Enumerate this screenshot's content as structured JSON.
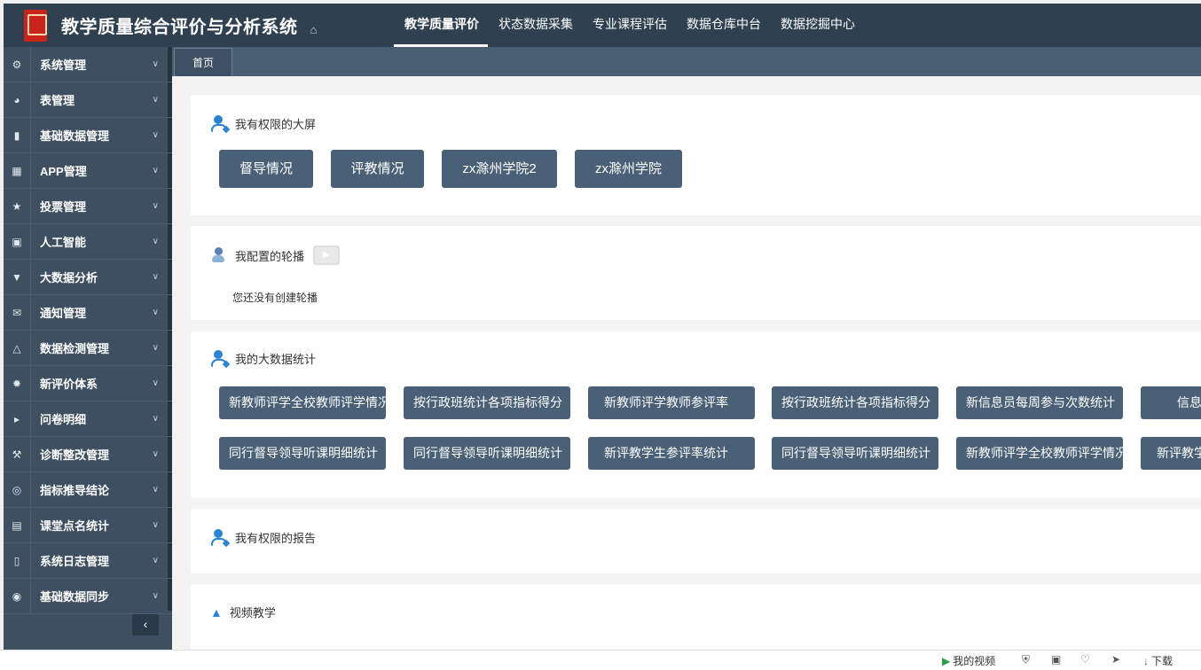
{
  "header": {
    "title": "教学质量综合评价与分析系统",
    "home_icon": "home-icon",
    "nav": [
      {
        "label": "教学质量评价",
        "active": true
      },
      {
        "label": "状态数据采集",
        "active": false
      },
      {
        "label": "专业课程评估",
        "active": false
      },
      {
        "label": "数据仓库中台",
        "active": false
      },
      {
        "label": "数据挖掘中心",
        "active": false
      }
    ]
  },
  "sidebar": {
    "items": [
      {
        "label": "系统管理",
        "icon": "gears-icon"
      },
      {
        "label": "表管理",
        "icon": "dashboard-icon"
      },
      {
        "label": "基础数据管理",
        "icon": "bookmark-icon"
      },
      {
        "label": "APP管理",
        "icon": "grid-icon"
      },
      {
        "label": "投票管理",
        "icon": "trophy-icon"
      },
      {
        "label": "人工智能",
        "icon": "archive-icon"
      },
      {
        "label": "大数据分析",
        "icon": "filter-icon"
      },
      {
        "label": "通知管理",
        "icon": "envelope-icon"
      },
      {
        "label": "数据检测管理",
        "icon": "flask-icon"
      },
      {
        "label": "新评价体系",
        "icon": "gear-icon"
      },
      {
        "label": "问卷明细",
        "icon": "bullhorn-icon"
      },
      {
        "label": "诊断整改管理",
        "icon": "wrench-icon"
      },
      {
        "label": "指标推导结论",
        "icon": "compass-icon"
      },
      {
        "label": "课堂点名统计",
        "icon": "bar-chart-icon"
      },
      {
        "label": "系统日志管理",
        "icon": "book-icon"
      },
      {
        "label": "基础数据同步",
        "icon": "eye-icon"
      }
    ],
    "collapse_label": "‹"
  },
  "tabs": [
    {
      "label": "首页"
    }
  ],
  "cards": {
    "screens": {
      "title": "我有权限的大屏",
      "buttons": [
        "督导情况",
        "评教情况",
        "zx滁州学院2",
        "zx滁州学院"
      ]
    },
    "carousel": {
      "title": "我配置的轮播",
      "empty_text": "您还没有创建轮播"
    },
    "stats": {
      "title": "我的大数据统计",
      "row1": [
        "新教师评学全校教师评学情况",
        "按行政班统计各项指标得分",
        "新教师评学教师参评率",
        "按行政班统计各项指标得分",
        "新信息员每周参与次数统计",
        "信息"
      ],
      "row2": [
        "同行督导领导听课明细统计",
        "同行督导领导听课明细统计",
        "新评教学生参评率统计",
        "同行督导领导听课明细统计",
        "新教师评学全校教师评学情况",
        "新评教学"
      ]
    },
    "reports": {
      "title": "我有权限的报告"
    },
    "videos": {
      "title": "视频教学"
    }
  },
  "statusbar": {
    "my_video": "我的视频",
    "download": "下载"
  }
}
